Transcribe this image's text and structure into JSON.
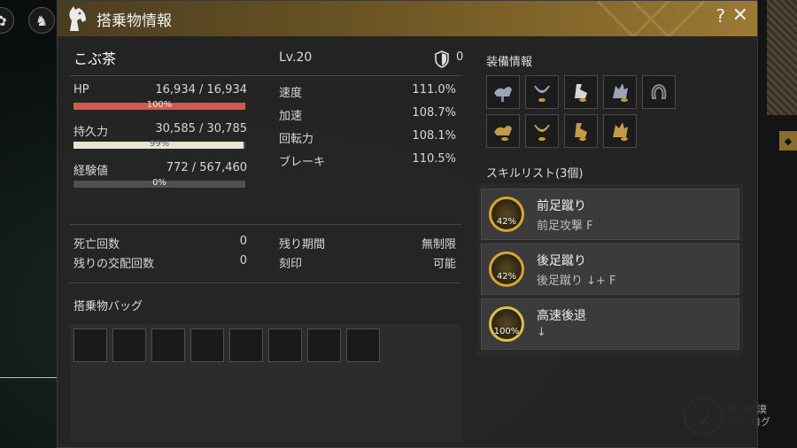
{
  "window": {
    "title": "搭乗物情報",
    "help_label": "?",
    "close_label": "✕"
  },
  "mount": {
    "name": "こぶ茶",
    "level": "Lv.20",
    "defense": "0"
  },
  "stats": [
    {
      "label": "HP",
      "value": "16,934 / 16,934",
      "bar_percent_text": "100%",
      "bar_fraction": 1.0,
      "bar_color": "#d25a48"
    },
    {
      "label": "持久力",
      "value": "30,585 / 30,785",
      "bar_percent_text": "99%",
      "bar_fraction": 0.99,
      "bar_color": "#e8e4d4"
    },
    {
      "label": "経験値",
      "value": "772 / 567,460",
      "bar_percent_text": "0%",
      "bar_fraction": 0.0,
      "bar_color": "#c9a04a"
    }
  ],
  "attributes": [
    {
      "label": "速度",
      "value": "111.0%"
    },
    {
      "label": "加速",
      "value": "108.7%"
    },
    {
      "label": "回転力",
      "value": "108.1%"
    },
    {
      "label": "ブレーキ",
      "value": "110.5%"
    }
  ],
  "info": {
    "death_count_label": "死亡回数",
    "death_count": "0",
    "breed_left_label": "残りの交配回数",
    "breed_left": "0",
    "time_left_label": "残り期間",
    "time_left": "無制限",
    "seal_label": "刻印",
    "seal": "可能"
  },
  "bag": {
    "title": "搭乗物バッグ",
    "slot_count": 8
  },
  "equipment": {
    "title": "装備情報",
    "slots_row1": [
      "saddle-icon",
      "stirrup-icon",
      "barding-icon",
      "chanfron-icon",
      "horseshoe-icon"
    ],
    "slots_row2": [
      "saddle-icon",
      "stirrup-icon",
      "barding-icon",
      "chanfron-icon"
    ]
  },
  "skills": {
    "title": "スキルリスト(3個)",
    "items": [
      {
        "name": "前足蹴り",
        "command": "前足攻撃  F",
        "percent": "42%"
      },
      {
        "name": "後足蹴り",
        "command": "後足蹴り ↓+ F",
        "percent": "42%"
      },
      {
        "name": "高速後退",
        "command": "↓",
        "percent": "100%"
      }
    ]
  },
  "watermark": {
    "glyph": "ソ",
    "line1": "黒い砂漠",
    "line2": "SSブログ"
  },
  "colors": {
    "accent_gold": "#9a7a35",
    "panel_bg": "#252525"
  }
}
